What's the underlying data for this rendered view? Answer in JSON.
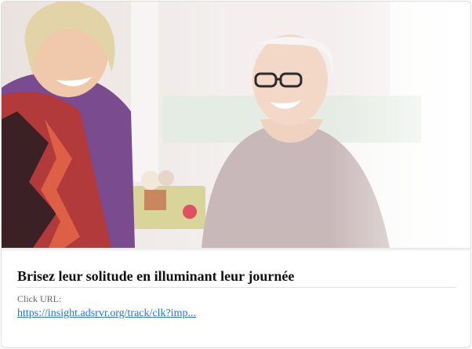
{
  "ad": {
    "image_alt": "Two smiling older women",
    "title": "Brisez leur solitude en illuminant leur journée",
    "click_label": "Click URL:",
    "click_url_text": "https://insight.adsrvr.org/track/clk?imp..."
  },
  "colors": {
    "link": "#2a6fdb",
    "title": "#111111",
    "label": "#666666"
  }
}
